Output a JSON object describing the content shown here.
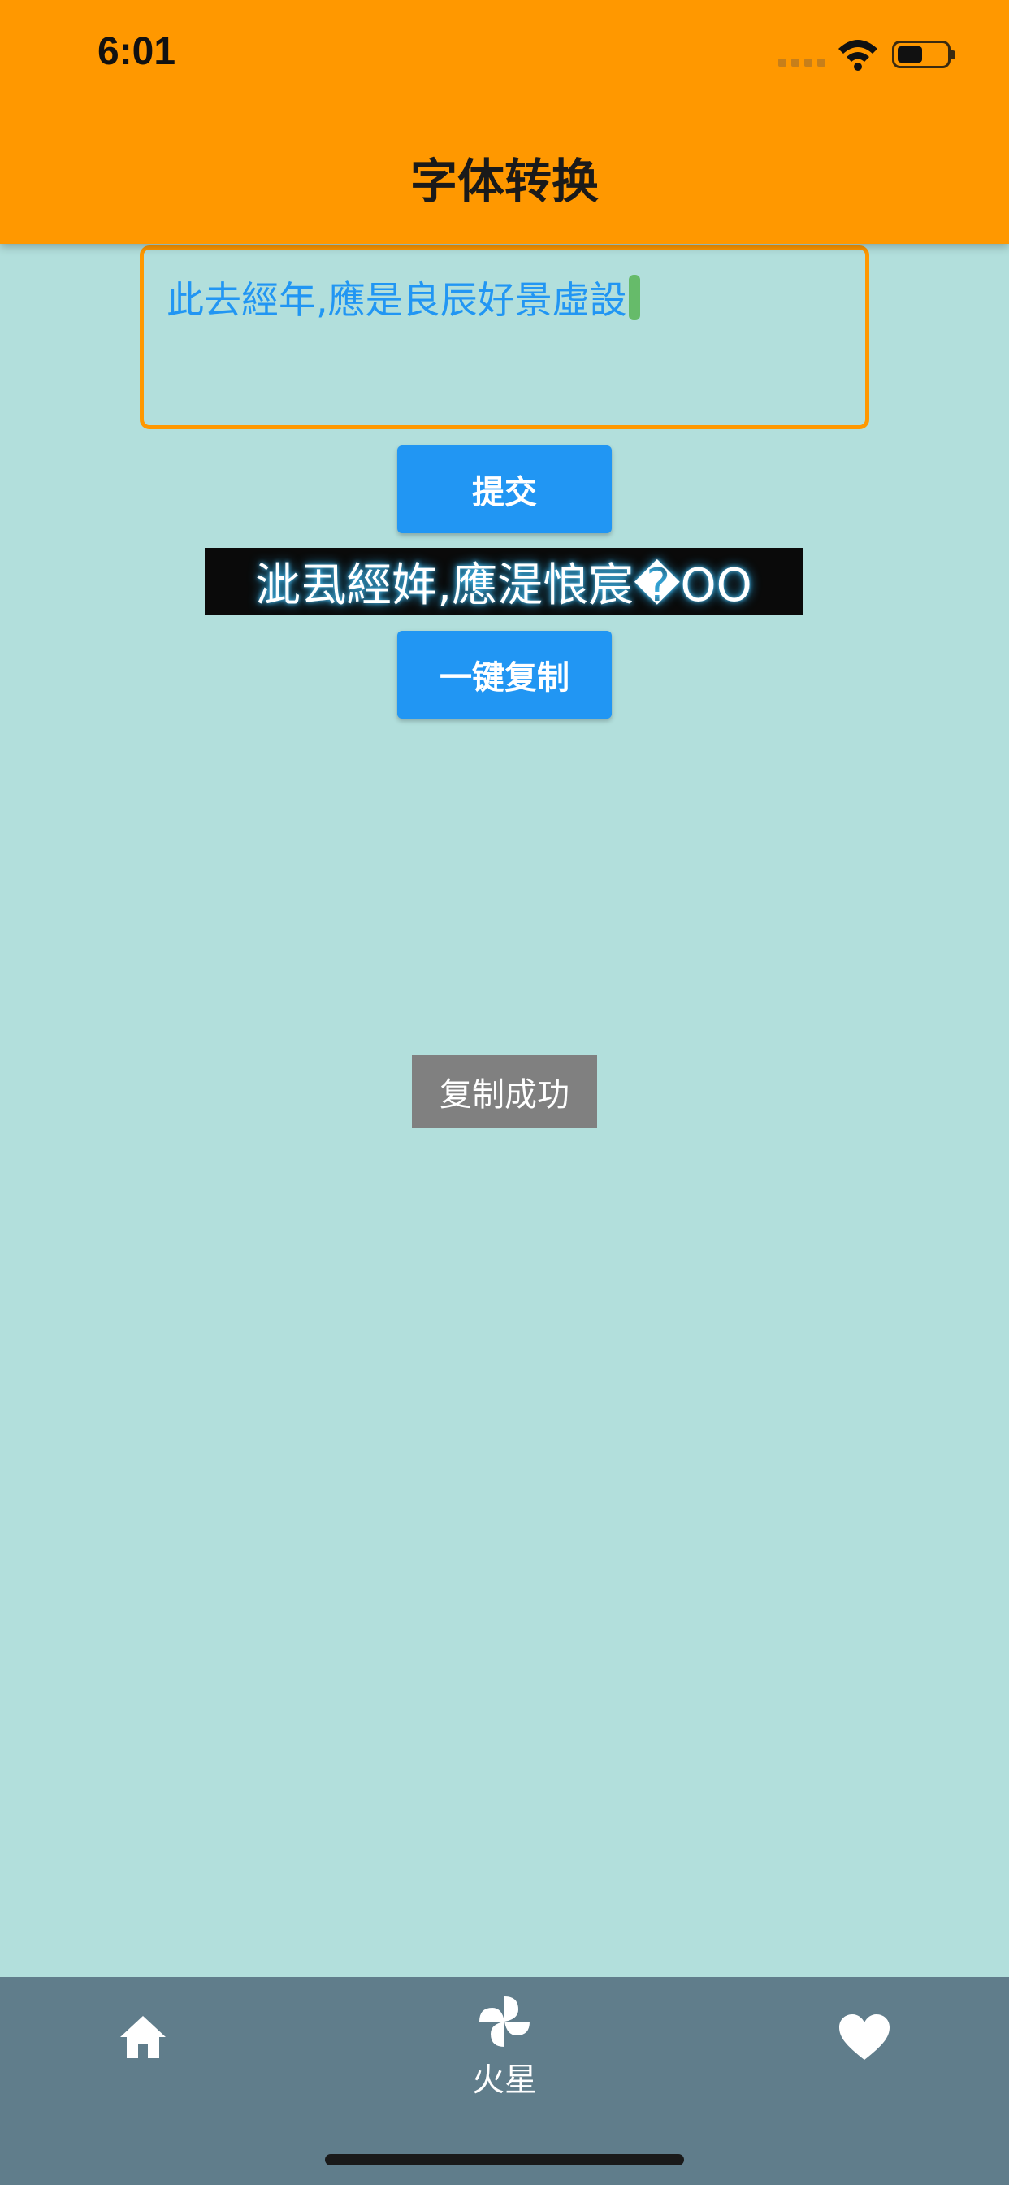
{
  "status_bar": {
    "time": "6:01"
  },
  "header": {
    "title": "字体转换"
  },
  "input": {
    "value": "此去經年,應是良辰好景虛設"
  },
  "buttons": {
    "submit_label": "提交",
    "copy_label": "一键复制"
  },
  "result": {
    "text": "泚厾經姩,應湜悢宸�OO"
  },
  "toast": {
    "message": "复制成功"
  },
  "tabbar": {
    "items": [
      {
        "icon": "home-icon",
        "label": ""
      },
      {
        "icon": "pinwheel-icon",
        "label": "火星"
      },
      {
        "icon": "heart-icon",
        "label": ""
      }
    ]
  },
  "colors": {
    "header": "#ff9800",
    "background": "#b2dfdc",
    "button": "#2196f3",
    "tabbar": "#607d8b",
    "input_text": "#2196f3",
    "toast": "#808080"
  }
}
